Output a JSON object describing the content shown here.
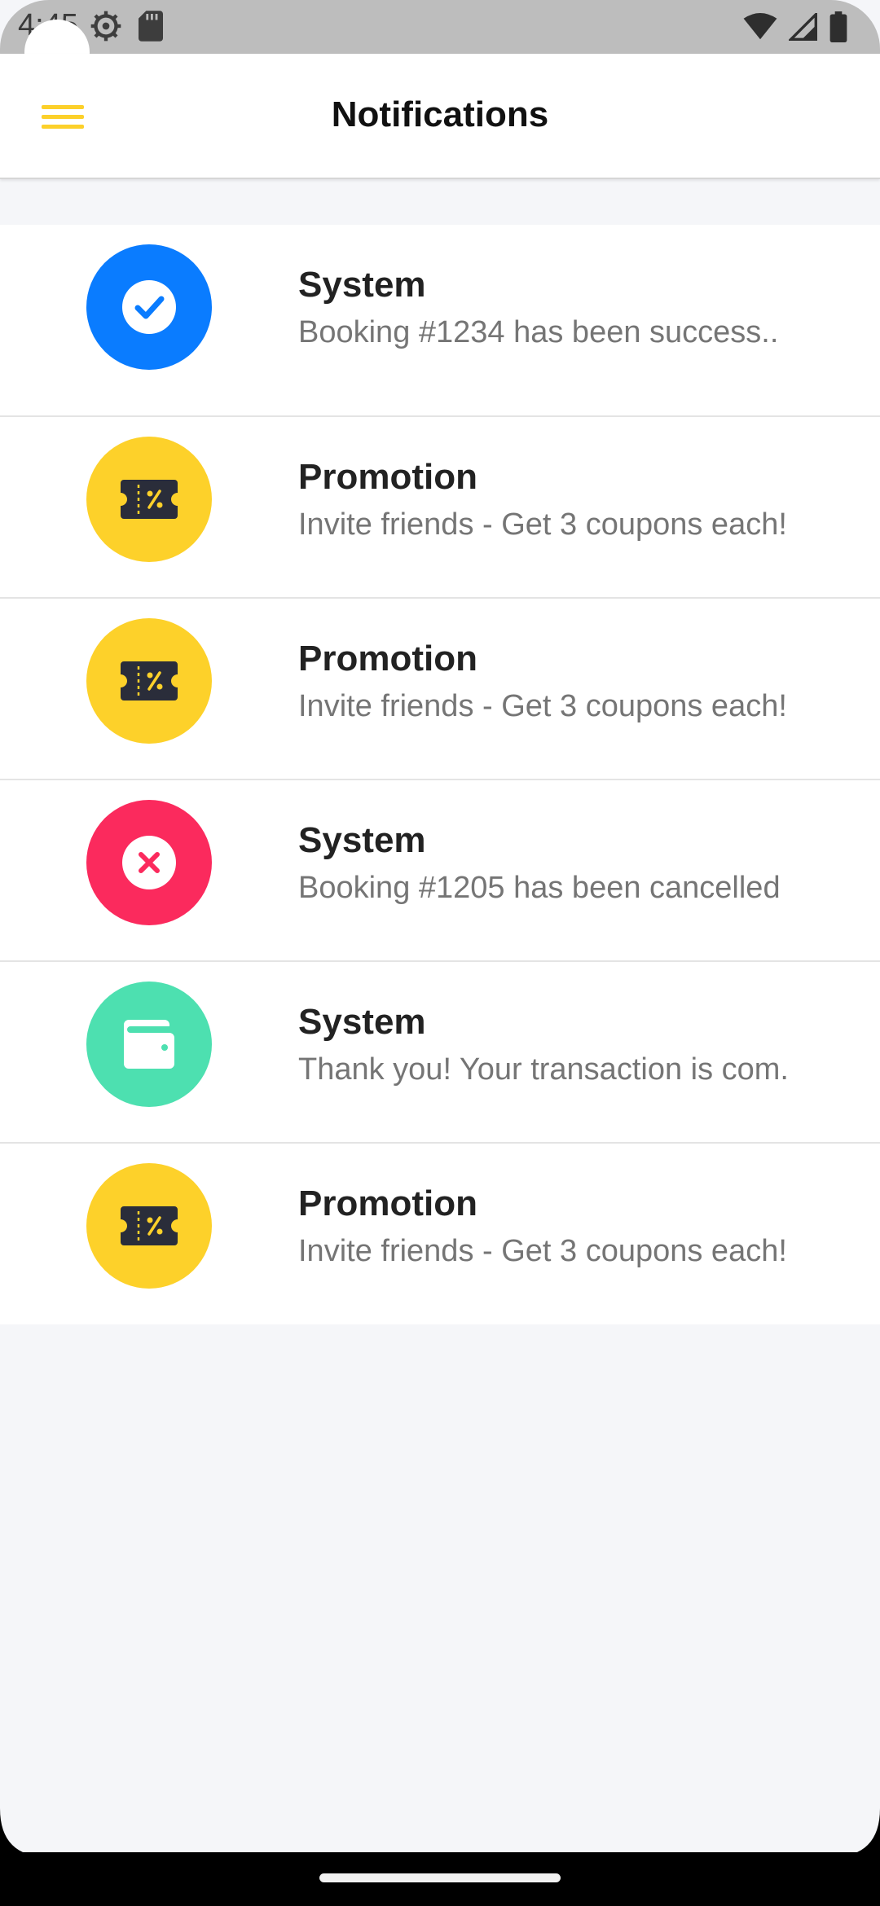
{
  "status_bar": {
    "time": "4:45"
  },
  "app_bar": {
    "title": "Notifications",
    "menu_icon": "hamburger-menu-icon"
  },
  "colors": {
    "accent": "#fcd02a",
    "system_success": "#0a7cff",
    "promotion": "#fdd12a",
    "system_cancel": "#fb2a5d",
    "system_wallet": "#4de0b0"
  },
  "notifications": [
    {
      "type": "System",
      "message": "Booking #1234 has been success..",
      "icon": "check-icon",
      "color": "#0a7cff"
    },
    {
      "type": "Promotion",
      "message": "Invite friends - Get 3 coupons each!",
      "icon": "ticket-percent-icon",
      "color": "#fdd12a"
    },
    {
      "type": "Promotion",
      "message": "Invite friends - Get 3 coupons each!",
      "icon": "ticket-percent-icon",
      "color": "#fdd12a"
    },
    {
      "type": "System",
      "message": "Booking #1205 has been cancelled",
      "icon": "close-icon",
      "color": "#fb2a5d"
    },
    {
      "type": "System",
      "message": "Thank you! Your transaction is com.",
      "icon": "wallet-icon",
      "color": "#4de0b0"
    },
    {
      "type": "Promotion",
      "message": "Invite friends - Get 3 coupons each!",
      "icon": "ticket-percent-icon",
      "color": "#fdd12a"
    }
  ]
}
